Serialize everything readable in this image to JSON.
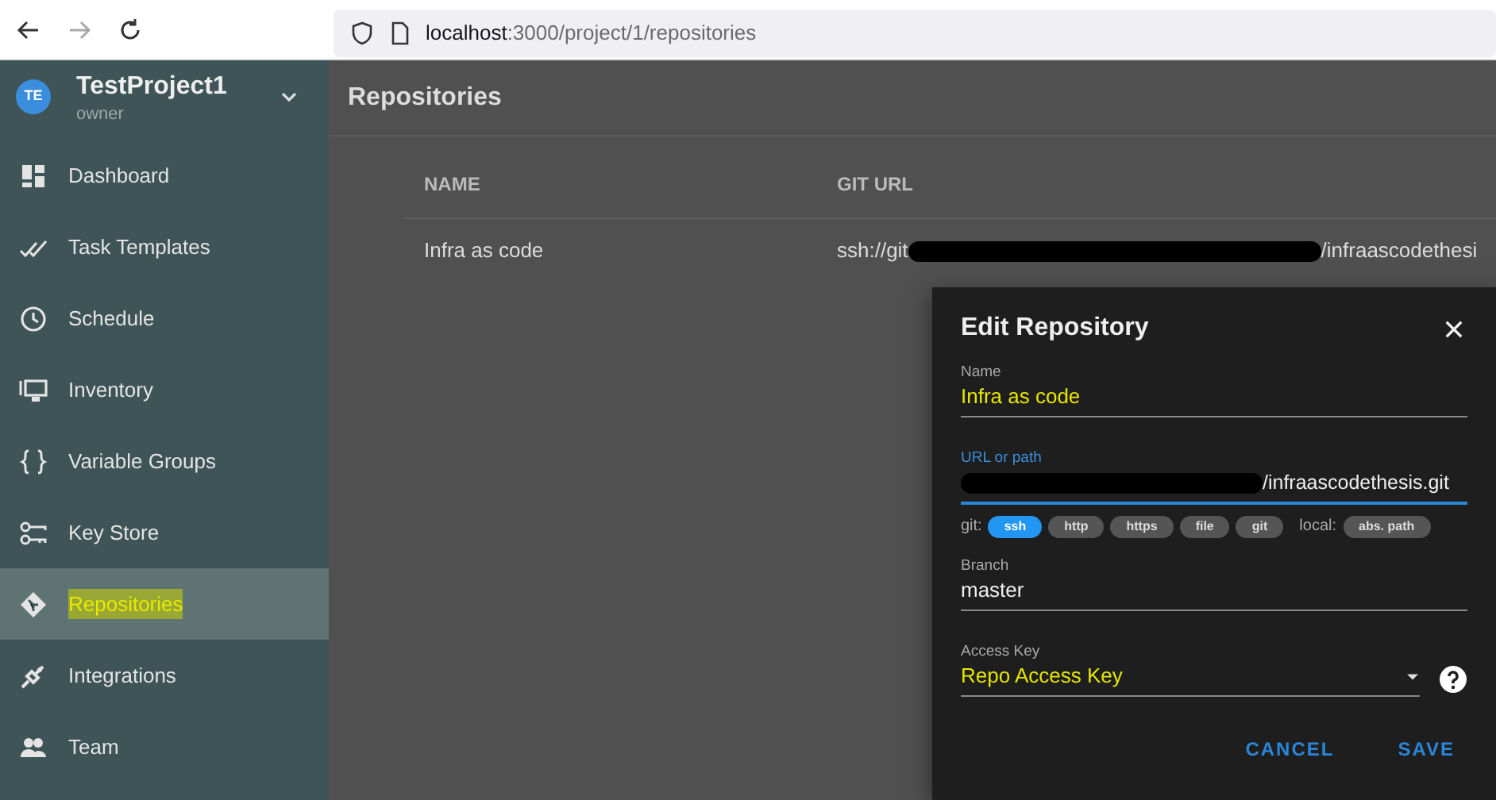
{
  "browser": {
    "url_host": "localhost",
    "url_path": ":3000/project/1/repositories",
    "forward_disabled": true
  },
  "project": {
    "avatar": "TE",
    "name": "TestProject1",
    "role": "owner"
  },
  "sidebar": {
    "items": [
      {
        "label": "Dashboard",
        "selected": false,
        "highlighted": false
      },
      {
        "label": "Task Templates",
        "selected": false,
        "highlighted": false
      },
      {
        "label": "Schedule",
        "selected": false,
        "highlighted": false
      },
      {
        "label": "Inventory",
        "selected": false,
        "highlighted": false
      },
      {
        "label": "Variable Groups",
        "selected": false,
        "highlighted": false
      },
      {
        "label": "Key Store",
        "selected": false,
        "highlighted": false
      },
      {
        "label": "Repositories",
        "selected": true,
        "highlighted": true
      },
      {
        "label": "Integrations",
        "selected": false,
        "highlighted": false
      },
      {
        "label": "Team",
        "selected": false,
        "highlighted": false
      }
    ]
  },
  "page_title": "Repositories",
  "table": {
    "columns": [
      "NAME",
      "GIT URL"
    ],
    "rows": [
      {
        "name": "Infra as code",
        "git_url_start": "ssh://git",
        "git_url_end": "/infraascodethesi"
      }
    ]
  },
  "dialog": {
    "title": "Edit Repository",
    "name_field": {
      "label": "Name",
      "value": "Infra as code",
      "highlighted": true
    },
    "url_field": {
      "label": "URL or path",
      "value_end": "/infraascodethesis.git",
      "focused": true
    },
    "protocol_groups": [
      {
        "label": "git:",
        "chips": [
          {
            "label": "ssh",
            "selected": true
          },
          {
            "label": "http",
            "selected": false
          },
          {
            "label": "https",
            "selected": false
          },
          {
            "label": "file",
            "selected": false
          },
          {
            "label": "git",
            "selected": false
          }
        ]
      },
      {
        "label": "local:",
        "chips": [
          {
            "label": "abs. path",
            "selected": false
          }
        ]
      }
    ],
    "branch_field": {
      "label": "Branch",
      "value": "master"
    },
    "access_key_field": {
      "label": "Access Key",
      "value": "Repo Access Key",
      "highlighted": true
    },
    "buttons": [
      "CANCEL",
      "SAVE"
    ]
  }
}
